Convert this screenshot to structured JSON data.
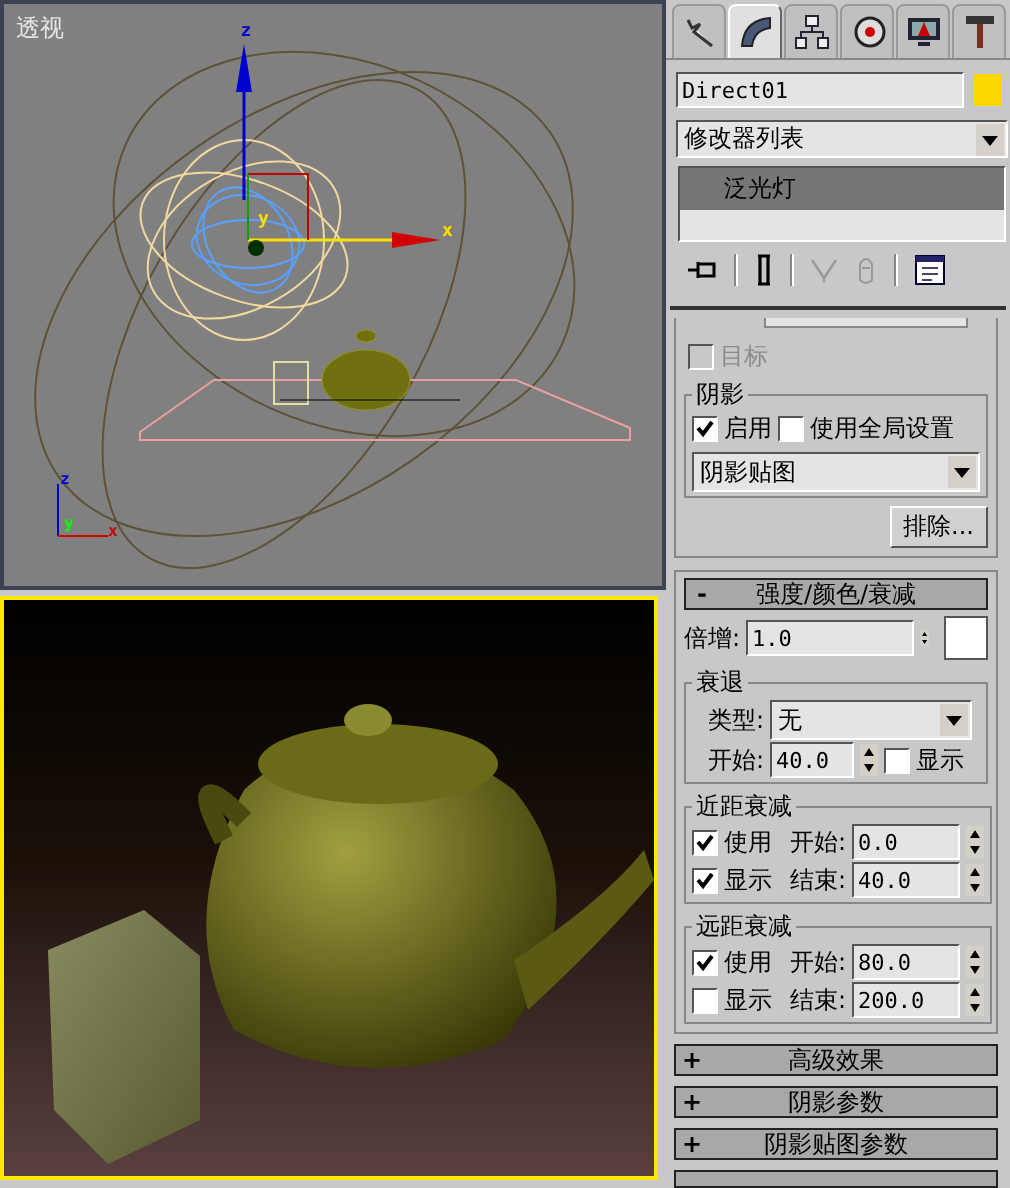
{
  "viewport": {
    "label": "透视",
    "gizmo_axes": [
      "z",
      "y",
      "x"
    ],
    "tripod_axes": [
      "z",
      "y",
      "x"
    ]
  },
  "render_view": {
    "active": true
  },
  "command_tabs": [
    {
      "kind": "create",
      "selected": false
    },
    {
      "kind": "modify",
      "selected": true
    },
    {
      "kind": "hierarchy",
      "selected": false
    },
    {
      "kind": "motion",
      "selected": false
    },
    {
      "kind": "display",
      "selected": false
    },
    {
      "kind": "utilities",
      "selected": false
    }
  ],
  "object": {
    "name": "Direct01",
    "color": "#ffd800"
  },
  "modifier_list": {
    "value": "修改器列表"
  },
  "stack": [
    {
      "label": "泛光灯",
      "selected": true
    }
  ],
  "target": {
    "label": "目标",
    "checked": false,
    "disabled": true
  },
  "shadows": {
    "title": "阴影",
    "enabled": {
      "label": "启用",
      "checked": true
    },
    "global": {
      "label": "使用全局设置",
      "checked": false
    },
    "type": "阴影贴图",
    "exclude": "排除..."
  },
  "intensity": {
    "toggle": "-",
    "title": "强度/颜色/衰减",
    "multiplier_label": "倍增:",
    "multiplier": "1.0",
    "color": "#ffffff",
    "decay": {
      "title": "衰退",
      "type_label": "类型:",
      "type": "无",
      "start_label": "开始:",
      "start": "40.0",
      "show": {
        "label": "显示",
        "checked": false
      }
    },
    "near": {
      "title": "近距衰减",
      "use": {
        "label": "使用",
        "checked": true
      },
      "show": {
        "label": "显示",
        "checked": true
      },
      "start_label": "开始:",
      "start": "0.0",
      "end_label": "结束:",
      "end": "40.0"
    },
    "far": {
      "title": "远距衰减",
      "use": {
        "label": "使用",
        "checked": true
      },
      "show": {
        "label": "显示",
        "checked": false
      },
      "start_label": "开始:",
      "start": "80.0",
      "end_label": "结束:",
      "end": "200.0"
    }
  },
  "rollouts": [
    {
      "toggle": "+",
      "title": "高级效果"
    },
    {
      "toggle": "+",
      "title": "阴影参数"
    },
    {
      "toggle": "+",
      "title": "阴影贴图参数"
    }
  ]
}
